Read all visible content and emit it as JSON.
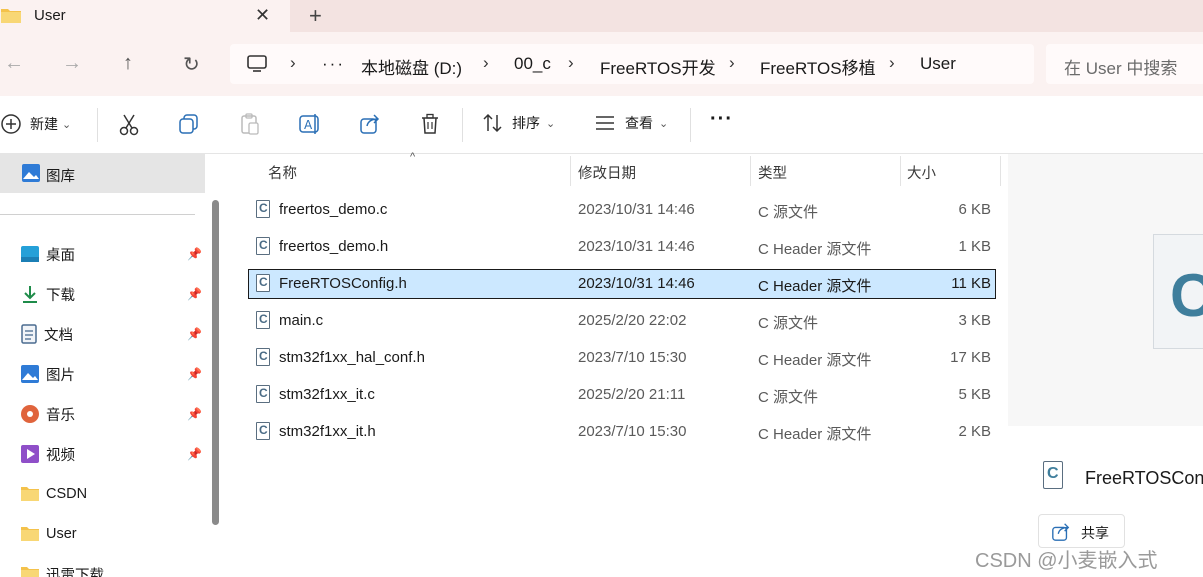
{
  "tab": {
    "title": "User",
    "close_glyph": "✕",
    "new_tab_glyph": "+"
  },
  "nav": {
    "back": "←",
    "forward": "→",
    "up": "↑",
    "refresh": "↻"
  },
  "address": {
    "ellipsis": "···",
    "crumbs": [
      "本地磁盘 (D:)",
      "00_c",
      "FreeRTOS开发",
      "FreeRTOS移植",
      "User"
    ],
    "separator": "›"
  },
  "search": {
    "placeholder": "在 User 中搜索"
  },
  "toolbar": {
    "new_label": "新建",
    "sort_label": "排序",
    "view_label": "查看",
    "more_label": "···",
    "chevron": "⌄"
  },
  "sidebar": {
    "gallery": "图库",
    "items": [
      {
        "label": "桌面",
        "pinned": true
      },
      {
        "label": "下载",
        "pinned": true
      },
      {
        "label": "文档",
        "pinned": true
      },
      {
        "label": "图片",
        "pinned": true
      },
      {
        "label": "音乐",
        "pinned": true
      },
      {
        "label": "视频",
        "pinned": true
      },
      {
        "label": "CSDN",
        "pinned": false
      },
      {
        "label": "User",
        "pinned": false
      },
      {
        "label": "迅雷下载",
        "pinned": false
      }
    ]
  },
  "columns": {
    "name": "名称",
    "modified": "修改日期",
    "type": "类型",
    "size": "大小"
  },
  "files": [
    {
      "name": "freertos_demo.c",
      "modified": "2023/10/31 14:46",
      "type": "C 源文件",
      "size": "6 KB"
    },
    {
      "name": "freertos_demo.h",
      "modified": "2023/10/31 14:46",
      "type": "C Header 源文件",
      "size": "1 KB"
    },
    {
      "name": "FreeRTOSConfig.h",
      "modified": "2023/10/31 14:46",
      "type": "C Header 源文件",
      "size": "11 KB",
      "selected": true
    },
    {
      "name": "main.c",
      "modified": "2025/2/20 22:02",
      "type": "C 源文件",
      "size": "3 KB"
    },
    {
      "name": "stm32f1xx_hal_conf.h",
      "modified": "2023/7/10 15:30",
      "type": "C Header 源文件",
      "size": "17 KB"
    },
    {
      "name": "stm32f1xx_it.c",
      "modified": "2025/2/20 21:11",
      "type": "C 源文件",
      "size": "5 KB"
    },
    {
      "name": "stm32f1xx_it.h",
      "modified": "2023/7/10 15:30",
      "type": "C Header 源文件",
      "size": "2 KB"
    }
  ],
  "preview": {
    "file_name": "FreeRTOSConfig.h",
    "share_label": "共享",
    "big_glyph": "C"
  },
  "watermark": "CSDN @小麦嵌入式",
  "colors": {
    "selection": "#cce8ff",
    "tab_bg": "#fbf2f1",
    "accent": "#0067c0",
    "folder": "#f4c24b"
  }
}
